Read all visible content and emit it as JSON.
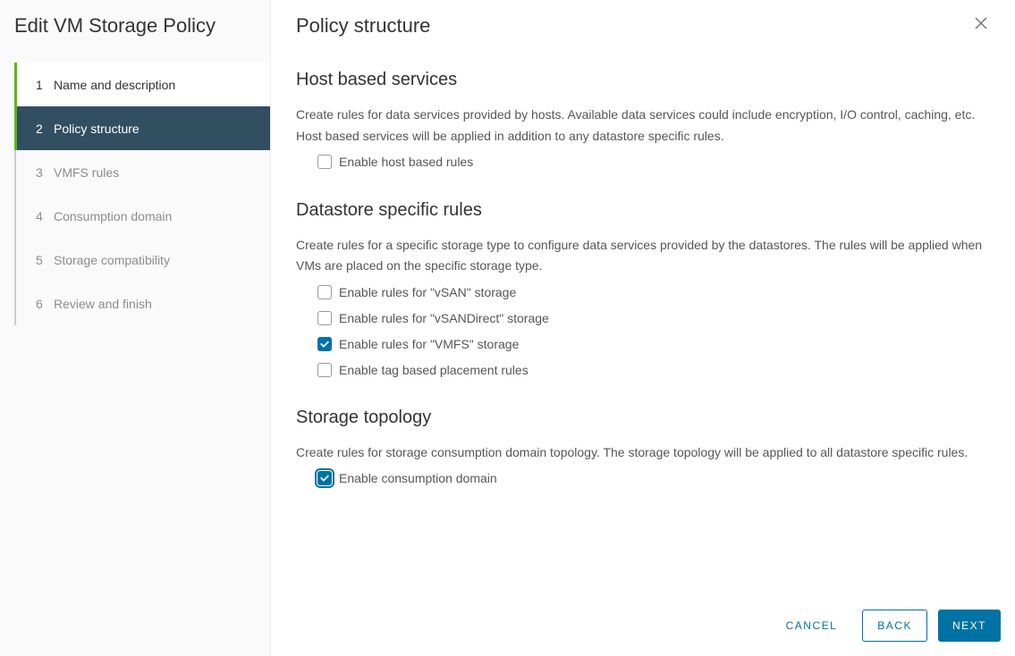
{
  "sidebar": {
    "title": "Edit VM Storage Policy",
    "steps": [
      {
        "num": "1",
        "label": "Name and description",
        "state": "visited"
      },
      {
        "num": "2",
        "label": "Policy structure",
        "state": "active"
      },
      {
        "num": "3",
        "label": "VMFS rules",
        "state": "inactive"
      },
      {
        "num": "4",
        "label": "Consumption domain",
        "state": "inactive"
      },
      {
        "num": "5",
        "label": "Storage compatibility",
        "state": "inactive"
      },
      {
        "num": "6",
        "label": "Review and finish",
        "state": "inactive"
      }
    ]
  },
  "content": {
    "title": "Policy structure",
    "sections": {
      "host": {
        "title": "Host based services",
        "desc": "Create rules for data services provided by hosts. Available data services could include encryption, I/O control, caching, etc. Host based services will be applied in addition to any datastore specific rules.",
        "options": [
          {
            "label": "Enable host based rules",
            "checked": false,
            "focus": false
          }
        ]
      },
      "datastore": {
        "title": "Datastore specific rules",
        "desc": "Create rules for a specific storage type to configure data services provided by the datastores. The rules will be applied when VMs are placed on the specific storage type.",
        "options": [
          {
            "label": "Enable rules for \"vSAN\" storage",
            "checked": false,
            "focus": false
          },
          {
            "label": "Enable rules for \"vSANDirect\" storage",
            "checked": false,
            "focus": false
          },
          {
            "label": "Enable rules for \"VMFS\" storage",
            "checked": true,
            "focus": false
          },
          {
            "label": "Enable tag based placement rules",
            "checked": false,
            "focus": false
          }
        ]
      },
      "topology": {
        "title": "Storage topology",
        "desc": "Create rules for storage consumption domain topology. The storage topology will be applied to all datastore specific rules.",
        "options": [
          {
            "label": "Enable consumption domain",
            "checked": true,
            "focus": true
          }
        ]
      }
    }
  },
  "footer": {
    "cancel": "CANCEL",
    "back": "BACK",
    "next": "NEXT"
  }
}
